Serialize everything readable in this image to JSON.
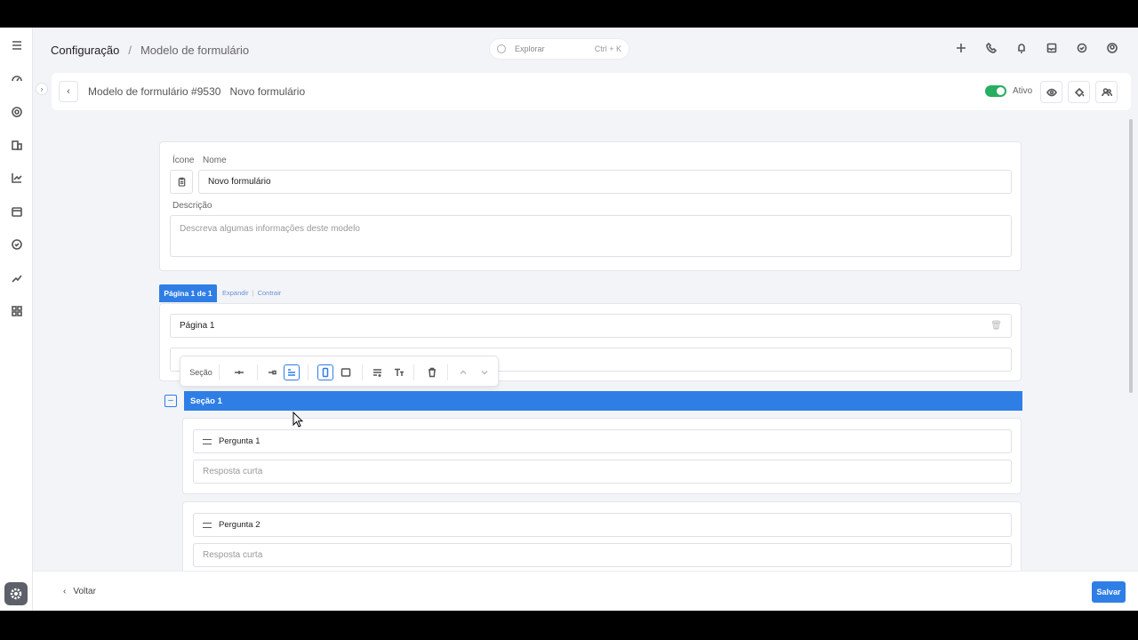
{
  "breadcrumb": {
    "root": "Configuração",
    "separator": "/",
    "current": "Modelo de formulário"
  },
  "search": {
    "placeholder": "Explorar",
    "shortcut": "Ctrl + K"
  },
  "header": {
    "model_id": "Modelo de formulário #9530",
    "form_name": "Novo formulário",
    "status_label": "Ativo",
    "status_active": true
  },
  "form": {
    "icon_label": "Ícone",
    "name_label": "Nome",
    "name_value": "Novo formulário",
    "description_label": "Descrição",
    "description_placeholder": "Descreva algumas informações deste modelo"
  },
  "pages": {
    "tab_label": "Página 1 de 1",
    "expand": "Expandir",
    "collapse": "Contrair",
    "page_title": "Página 1"
  },
  "toolbar": {
    "section_label": "Seção"
  },
  "section": {
    "title": "Seção 1"
  },
  "questions": [
    {
      "title": "Pergunta 1",
      "answer_placeholder": "Resposta curta"
    },
    {
      "title": "Pergunta 2",
      "answer_placeholder": "Resposta curta"
    }
  ],
  "footer": {
    "back_label": "Voltar",
    "save_label": "Salvar"
  },
  "colors": {
    "accent": "#2f7ee6",
    "toggle": "#27ae60"
  }
}
